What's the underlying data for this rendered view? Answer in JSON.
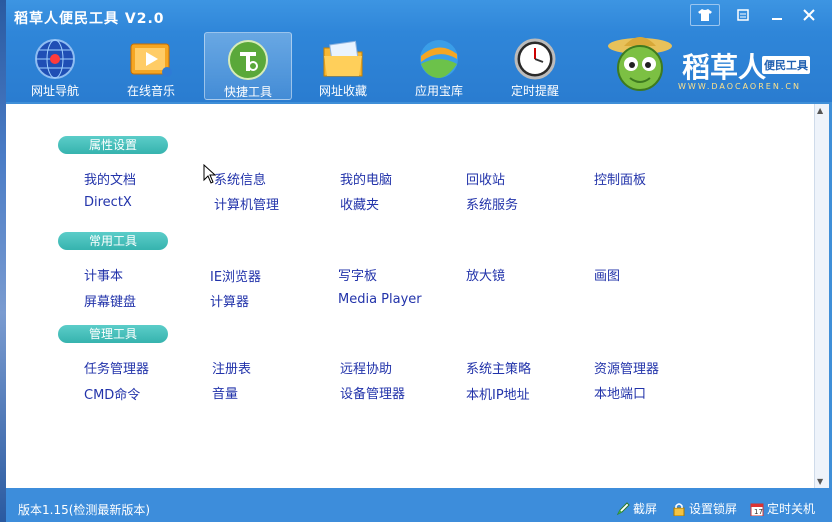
{
  "window": {
    "title": "稻草人便民工具 V2.0"
  },
  "toolbar": {
    "tools": [
      {
        "label": "网址导航",
        "icon": "globe-icon"
      },
      {
        "label": "在线音乐",
        "icon": "music-video-icon"
      },
      {
        "label": "快捷工具",
        "icon": "wrench-icon"
      },
      {
        "label": "网址收藏",
        "icon": "folder-icon"
      },
      {
        "label": "应用宝库",
        "icon": "ball-icon"
      },
      {
        "label": "定时提醒",
        "icon": "clock-icon"
      }
    ],
    "active_index": 2
  },
  "logo": {
    "brand": "稻草人",
    "sub": "便民工具",
    "url": "WWW.DAOCAOREN.CN"
  },
  "sections": [
    {
      "title": "属性设置",
      "rows": [
        [
          "我的文档",
          "系统信息",
          "我的电脑",
          "回收站",
          "控制面板"
        ],
        [
          "DirectX",
          "计算机管理",
          "收藏夹",
          "系统服务"
        ]
      ]
    },
    {
      "title": "常用工具",
      "rows": [
        [
          "计事本",
          "IE浏览器",
          "写字板",
          "放大镜",
          "画图"
        ],
        [
          "屏幕键盘",
          "计算器",
          "Media Player"
        ]
      ]
    },
    {
      "title": "管理工具",
      "rows": [
        [
          "任务管理器",
          "注册表",
          "远程协助",
          "系统主策略",
          "资源管理器"
        ],
        [
          "CMD命令",
          "音量",
          "设备管理器",
          "本机IP地址",
          "本地端口"
        ]
      ]
    }
  ],
  "status": {
    "version": "版本1.15(检测最新版本)",
    "buttons": [
      "截屏",
      "设置锁屏",
      "定时关机"
    ]
  },
  "colors": {
    "titlebar": "#3d95e2",
    "pill": "#36b3ae",
    "link": "#2233aa"
  }
}
